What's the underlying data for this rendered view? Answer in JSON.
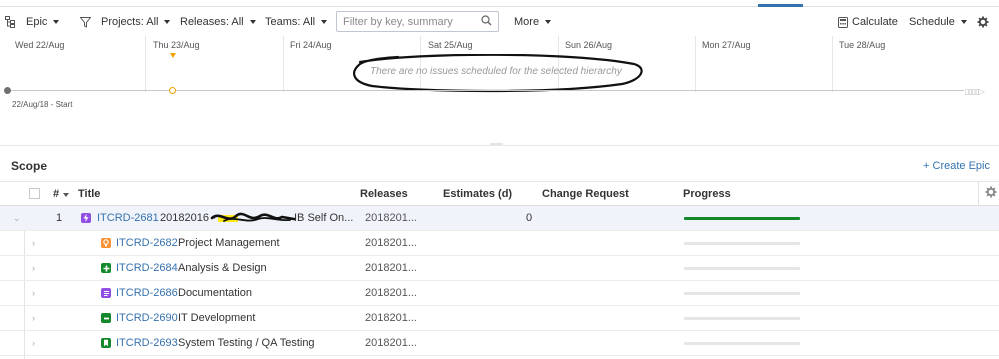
{
  "toolbar": {
    "hierarchy_label": "Epic",
    "projects_label": "Projects: All",
    "releases_label": "Releases: All",
    "teams_label": "Teams: All",
    "search_placeholder": "Filter by key, summary",
    "more_label": "More",
    "calculate_label": "Calculate",
    "schedule_label": "Schedule"
  },
  "timeline": {
    "days": [
      "Wed 22/Aug",
      "Thu 23/Aug",
      "Fri 24/Aug",
      "Sat 25/Aug",
      "Sun 26/Aug",
      "Mon 27/Aug",
      "Tue 28/Aug"
    ],
    "empty_message": "There are no issues scheduled for the selected hierarchy",
    "start_label": "22/Aug/18 - Start"
  },
  "scope": {
    "title": "Scope",
    "create_epic_label": "+ Create Epic",
    "columns": {
      "number": "#",
      "title": "Title",
      "releases": "Releases",
      "estimates": "Estimates (d)",
      "change_request": "Change Request",
      "progress": "Progress"
    },
    "rows": [
      {
        "num": "1",
        "key": "ITCRD-2681",
        "summary": "20182016 -",
        "summary_tail": "IB Self On...",
        "release": "2018201...",
        "estimate": "0",
        "progress": 1.0,
        "icon": "epic-icon",
        "icon_color": "#904ee2"
      },
      {
        "num": "",
        "key": "ITCRD-2682",
        "summary": "Project Management",
        "summary_tail": "",
        "release": "2018201...",
        "estimate": "",
        "progress": 0,
        "icon": "idea-icon",
        "icon_color": "#f79232"
      },
      {
        "num": "",
        "key": "ITCRD-2684",
        "summary": "Analysis & Design",
        "summary_tail": "",
        "release": "2018201...",
        "estimate": "",
        "progress": 0,
        "icon": "new-feature-icon",
        "icon_color": "#14892c"
      },
      {
        "num": "",
        "key": "ITCRD-2686",
        "summary": "Documentation",
        "summary_tail": "",
        "release": "2018201...",
        "estimate": "",
        "progress": 0,
        "icon": "documentation-icon",
        "icon_color": "#904ee2"
      },
      {
        "num": "",
        "key": "ITCRD-2690",
        "summary": "IT Development",
        "summary_tail": "",
        "release": "2018201...",
        "estimate": "",
        "progress": 0,
        "icon": "development-icon",
        "icon_color": "#14892c"
      },
      {
        "num": "",
        "key": "ITCRD-2693",
        "summary": "System Testing / QA Testing",
        "summary_tail": "",
        "release": "2018201...",
        "estimate": "",
        "progress": 0,
        "icon": "story-icon",
        "icon_color": "#14892c"
      }
    ]
  }
}
